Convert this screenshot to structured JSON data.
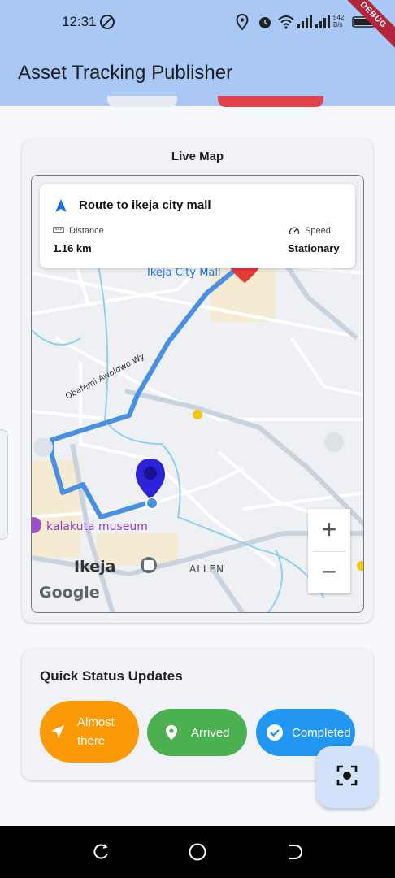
{
  "status_bar": {
    "time": "12:31",
    "net_rate_top": "542",
    "net_rate_bottom": "B/s",
    "debug_label": "DEBUG"
  },
  "app_bar": {
    "title": "Asset Tracking Publisher"
  },
  "live_map": {
    "title": "Live Map",
    "route_title": "Route to ikeja city mall",
    "distance_label": "Distance",
    "distance_value": "1.16 km",
    "speed_label": "Speed",
    "speed_value": "Stationary",
    "map_labels": {
      "destination": "Ikeja City Mall",
      "road": "Obafemi Awolowo Wy",
      "museum": "kalakuta museum",
      "district": "Ikeja",
      "area": "ALLEN",
      "attribution": "Google"
    },
    "zoom_in": "+",
    "zoom_out": "−"
  },
  "quick_status": {
    "title": "Quick Status Updates",
    "buttons": [
      {
        "label_line1": "Almost",
        "label_line2": "there",
        "color": "#fb9a06",
        "icon": "navigation-arrow-icon"
      },
      {
        "label": "Arrived",
        "color": "#4caf50",
        "icon": "location-pin-icon"
      },
      {
        "label": "Completed",
        "color": "#2196f3",
        "icon": "check-circle-icon"
      }
    ]
  },
  "colors": {
    "app_bar": "#a9c8f5",
    "route": "#4a90e2",
    "marker_asset": "#2b22d9",
    "marker_destination": "#e53935"
  }
}
